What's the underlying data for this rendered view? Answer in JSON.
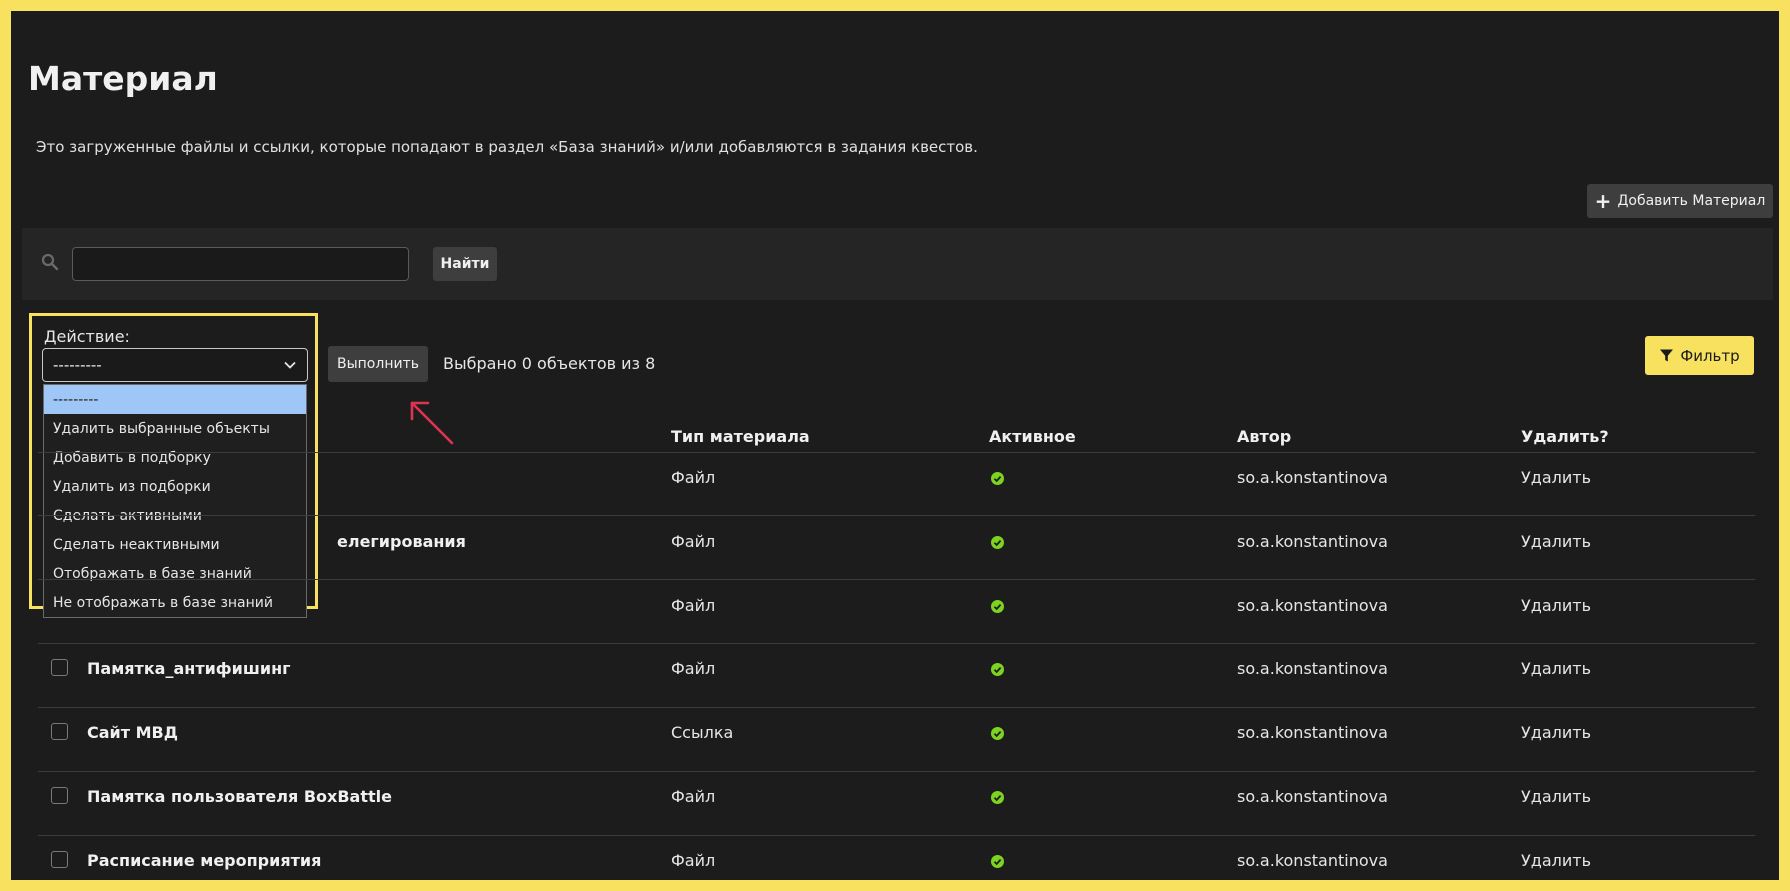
{
  "page": {
    "title": "Материал",
    "description": "Это загруженные файлы и ссылки, которые попадают в раздел «База знаний» и/или добавляются в задания квестов.",
    "add_button": "Добавить Материал"
  },
  "search": {
    "value": "",
    "button": "Найти"
  },
  "actions": {
    "label": "Действие:",
    "selected": "---------",
    "options": [
      "---------",
      "Удалить выбранные объекты",
      "Добавить в подборку",
      "Удалить из подборки",
      "Сделать активными",
      "Сделать неактивными",
      "Отображать в базе знаний",
      "Не отображать в базе знаний"
    ],
    "run_button": "Выполнить",
    "selected_count": "Выбрано 0 объектов из 8",
    "filter_button": "Фильтр"
  },
  "table": {
    "headers": [
      "Тип материала",
      "Активное",
      "Автор",
      "Удалить?"
    ],
    "rows": [
      {
        "name": "",
        "type": "Файл",
        "author": "so.a.konstantinova",
        "delete": "Удалить"
      },
      {
        "name": "елегирования",
        "type": "Файл",
        "author": "so.a.konstantinova",
        "delete": "Удалить"
      },
      {
        "name": "",
        "type": "Файл",
        "author": "so.a.konstantinova",
        "delete": "Удалить"
      },
      {
        "name": "Памятка_антифишинг",
        "type": "Файл",
        "author": "so.a.konstantinova",
        "delete": "Удалить"
      },
      {
        "name": "Сайт МВД",
        "type": "Ссылка",
        "author": "so.a.konstantinova",
        "delete": "Удалить"
      },
      {
        "name": "Памятка пользователя BoxBattle",
        "type": "Файл",
        "author": "so.a.konstantinova",
        "delete": "Удалить"
      },
      {
        "name": "Расписание мероприятия",
        "type": "Файл",
        "author": "so.a.konstantinova",
        "delete": "Удалить"
      }
    ]
  },
  "colors": {
    "accent": "#f7e15f",
    "active_check": "#7ed321",
    "annotation_arrow": "#e0334f",
    "dropdown_highlight": "#9ec7f7"
  }
}
